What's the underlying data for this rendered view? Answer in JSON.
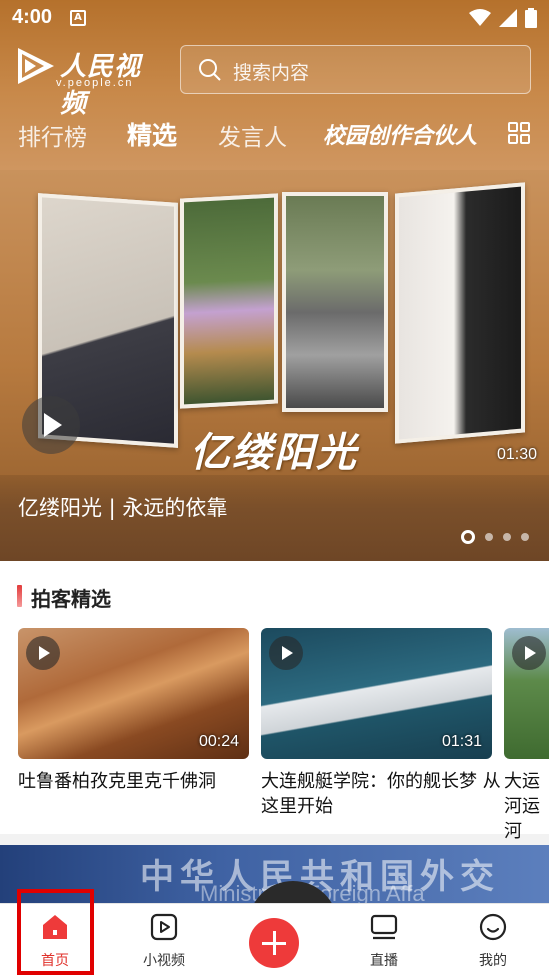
{
  "status_bar": {
    "time": "4:00",
    "notification_icon": "A"
  },
  "header": {
    "logo_title": "人民视频",
    "logo_url": "v.people.cn",
    "search_placeholder": "搜索内容",
    "tabs": [
      {
        "label": "排行榜",
        "active": false
      },
      {
        "label": "精选",
        "active": true
      },
      {
        "label": "发言人",
        "active": false
      },
      {
        "label": "校园创作合伙人",
        "active": false
      }
    ]
  },
  "banner": {
    "calligraphy": "亿缕阳光",
    "duration": "01:30",
    "caption": "亿缕阳光 | 永远的依靠",
    "page_count": 4,
    "active_page": 0
  },
  "section": {
    "title": "拍客精选",
    "cards": [
      {
        "caption": "吐鲁番柏孜克里克千佛洞",
        "duration": "00:24"
      },
      {
        "caption": "大连舰艇学院：你的舰长梦 从这里开始",
        "duration": "01:31"
      },
      {
        "caption": "大运河运河",
        "duration": ""
      }
    ]
  },
  "next_banner": {
    "text": "中华人民共和国外交",
    "sub": "Ministry of Foreign Affa"
  },
  "bottom_nav": {
    "items": [
      {
        "label": "首页",
        "icon": "home-icon",
        "active": true
      },
      {
        "label": "小视频",
        "icon": "short-video-icon",
        "active": false
      },
      {
        "label": "",
        "icon": "add-icon",
        "active": false
      },
      {
        "label": "直播",
        "icon": "live-tv-icon",
        "active": false
      },
      {
        "label": "我的",
        "icon": "profile-smile-icon",
        "active": false
      }
    ]
  },
  "colors": {
    "accent": "#e0312b",
    "header_brown": "#b5712c"
  }
}
